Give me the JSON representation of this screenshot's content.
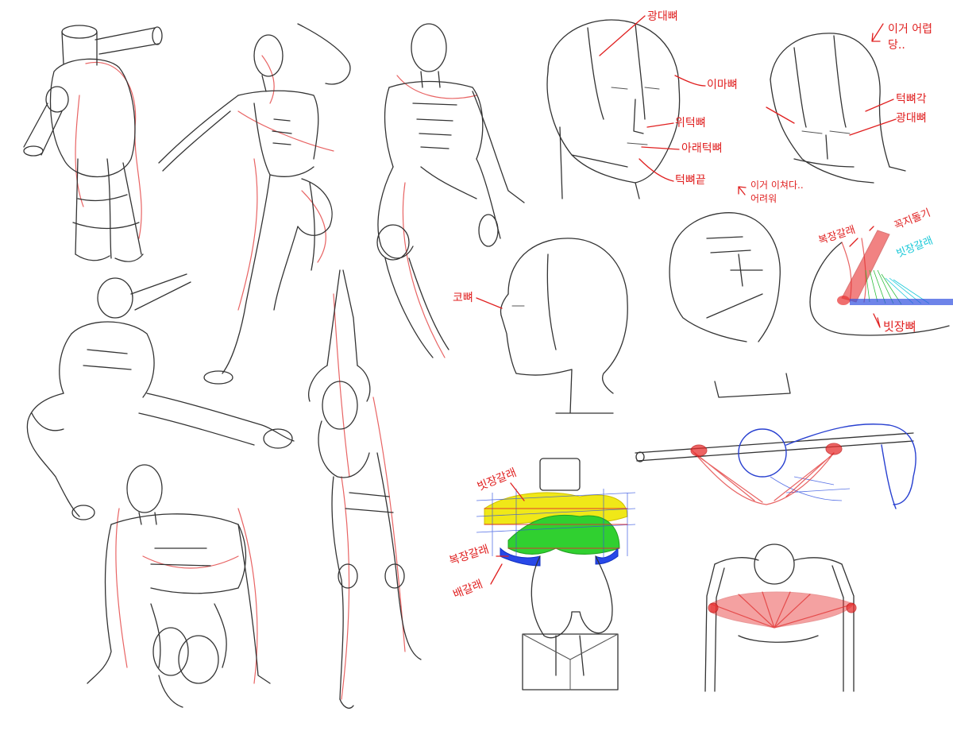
{
  "labels": {
    "cheekbone": "광대뼈",
    "forehead_bone": "이마뼈",
    "upper_jaw": "위턱뼈",
    "lower_jaw": "아래턱뼈",
    "chin": "턱뼈끝",
    "nose_bone": "코뼈",
    "note_hard": "이거 어렵당..",
    "jaw_angle": "턱뼈각",
    "cheekbone2": "광대뼈",
    "note_weird": "이거 이쳐다.. 어려워",
    "rib_cartilage": "복장갈래",
    "scm": "꼭지돌기",
    "clavicle_branch": "빗장갈래",
    "clavicle": "빗장뼈",
    "chest_clavicle": "빗장갈래",
    "chest_sternal": "복장갈래",
    "chest_abdominal": "배갈래"
  },
  "colors": {
    "annotation": "#e02020",
    "pencil": "#333333",
    "construction": "#e03030",
    "blue_sketch": "#2840d0",
    "pec_yellow": "#f0e818",
    "pec_green": "#30d030",
    "pec_blue": "#2848e8",
    "cyan_note": "#18c8d8"
  }
}
